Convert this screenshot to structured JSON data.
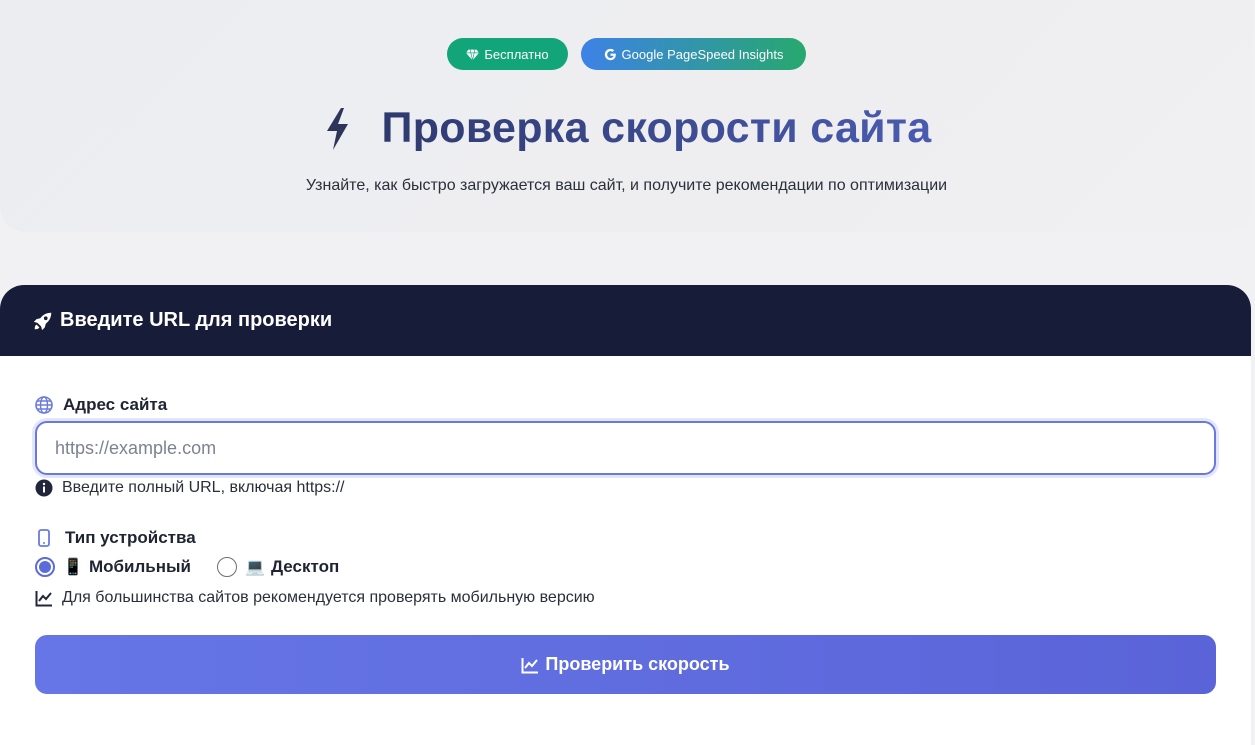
{
  "header": {
    "badges": [
      {
        "label": "Бесплатно",
        "icon": "gem-icon"
      },
      {
        "label": "Google PageSpeed Insights",
        "icon": "google-icon"
      }
    ],
    "title": "Проверка скорости сайта",
    "title_icon": "lightning-icon",
    "subtitle": "Узнайте, как быстро загружается ваш сайт, и получите рекомендации по оптимизации"
  },
  "form": {
    "heading": "Введите URL для проверки",
    "heading_icon": "rocket-icon",
    "url_label": "Адрес сайта",
    "url_value": "",
    "url_placeholder": "https://example.com",
    "url_hint": "Введите полный URL, включая https://",
    "device_label": "Тип устройства",
    "device_options": [
      {
        "label": "Мобильный",
        "emoji": "📱",
        "selected": true
      },
      {
        "label": "Десктоп",
        "emoji": "💻",
        "selected": false
      }
    ],
    "device_hint": "Для большинства сайтов рекомендуется проверять мобильную версию",
    "submit_label": "Проверить скорость"
  },
  "colors": {
    "accent": "#5c6bdc",
    "card_header": "#171d38",
    "badge_green": "#13a57a"
  }
}
